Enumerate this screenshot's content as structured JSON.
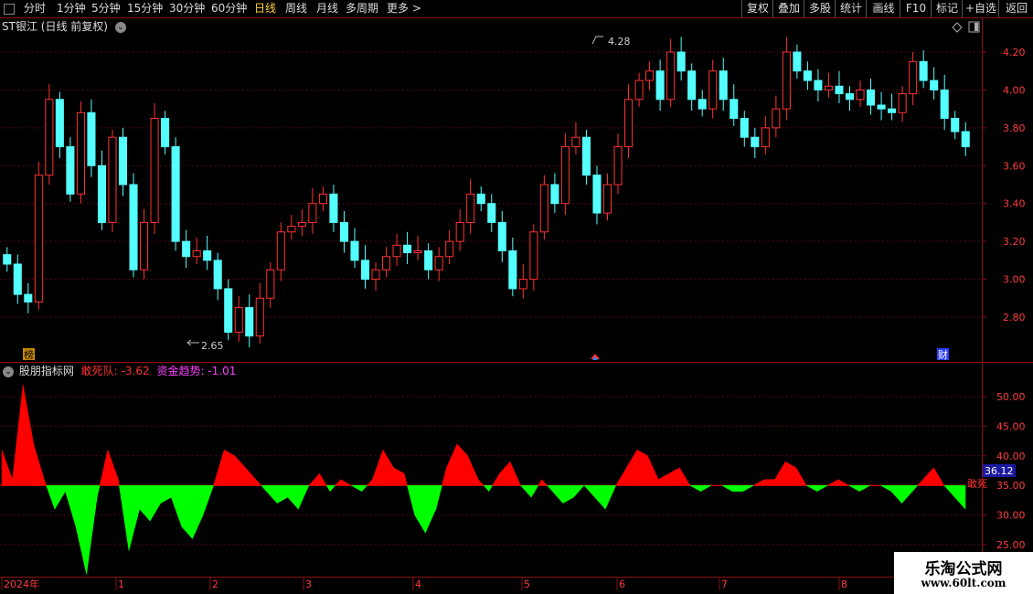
{
  "toolbar": {
    "periods": [
      "分时",
      "1分钟",
      "5分钟",
      "15分钟",
      "30分钟",
      "60分钟",
      "日线",
      "周线",
      "月线",
      "多周期",
      "更多 >"
    ],
    "active_period": "日线",
    "right_buttons": [
      "复权",
      "叠加",
      "多股",
      "统计",
      "画线",
      "F10",
      "标记",
      "+自选",
      "返回"
    ]
  },
  "main_chart": {
    "title": "ST银江 (日线 前复权)",
    "high_label": "4.28",
    "low_label": "2.65",
    "y_ticks": [
      "4.20",
      "4.00",
      "3.80",
      "3.60",
      "3.40",
      "3.20",
      "3.00",
      "2.80"
    ],
    "badge_left": "榜",
    "badge_right": "财",
    "up_color": "#ff3232",
    "down_color": "#54ffff"
  },
  "indicator": {
    "name": "股朋指标网",
    "line1_label": "敢死队:",
    "line1_value": "-3.62",
    "line2_label": "资金趋势:",
    "line2_value": "-1.01",
    "y_ticks": [
      "50.00",
      "45.00",
      "40.00",
      "35.00",
      "30.00",
      "25.00"
    ],
    "current_value_tag": "36.12",
    "side_label": "敢死",
    "pos_color": "#ff0000",
    "neg_color": "#00ff00"
  },
  "chart_data": [
    {
      "type": "candlestick",
      "title": "ST银江 (日线 前复权)",
      "ylim": [
        2.6,
        4.3
      ],
      "annotations": {
        "high": 4.28,
        "low": 2.65
      },
      "closes": [
        3.08,
        2.92,
        2.88,
        3.55,
        3.95,
        3.7,
        3.45,
        3.88,
        3.6,
        3.3,
        3.75,
        3.5,
        3.05,
        3.3,
        3.85,
        3.7,
        3.2,
        3.12,
        3.15,
        3.1,
        2.95,
        2.72,
        2.85,
        2.7,
        2.9,
        3.05,
        3.25,
        3.28,
        3.3,
        3.4,
        3.45,
        3.3,
        3.2,
        3.1,
        3.0,
        3.05,
        3.12,
        3.18,
        3.14,
        3.15,
        3.05,
        3.12,
        3.2,
        3.3,
        3.45,
        3.4,
        3.3,
        3.15,
        2.95,
        3.0,
        3.25,
        3.5,
        3.4,
        3.7,
        3.75,
        3.55,
        3.35,
        3.5,
        3.7,
        3.95,
        4.05,
        4.1,
        3.95,
        4.2,
        4.1,
        3.95,
        3.9,
        4.1,
        3.95,
        3.85,
        3.75,
        3.7,
        3.8,
        3.9,
        4.2,
        4.1,
        4.05,
        4.0,
        4.02,
        3.98,
        3.95,
        4.0,
        3.92,
        3.9,
        3.88,
        3.98,
        4.15,
        4.05,
        4.0,
        3.85,
        3.78,
        3.7
      ],
      "x_labels": [
        "2024年",
        "1",
        "2",
        "3",
        "4",
        "5",
        "6",
        "7",
        "8"
      ]
    },
    {
      "type": "area",
      "title": "股朋指标网",
      "ylim": [
        25,
        55
      ],
      "baseline": 35,
      "series": [
        {
          "name": "敢死队",
          "values": [
            41,
            36,
            52,
            42,
            36,
            31,
            34,
            28,
            20,
            33,
            41,
            36,
            24,
            31,
            29,
            32,
            33,
            28,
            26,
            30,
            35,
            41,
            40,
            38,
            36,
            34,
            32,
            33,
            31,
            35,
            37,
            34,
            36,
            35,
            34,
            36,
            41,
            38,
            37,
            30,
            27,
            31,
            38,
            42,
            40,
            36,
            34,
            37,
            39,
            35,
            33,
            36,
            34,
            32,
            33,
            35,
            33,
            31,
            35,
            38,
            41,
            40,
            36,
            37,
            38,
            35,
            34,
            35,
            35,
            34,
            34,
            35,
            36,
            36,
            39,
            38,
            35,
            34,
            35,
            36,
            35,
            34,
            35,
            35,
            34,
            32,
            34,
            36,
            38,
            35,
            33,
            31
          ],
          "last": -3.62
        },
        {
          "name": "资金趋势",
          "last": -1.01
        }
      ],
      "current_tag": 36.12
    }
  ]
}
